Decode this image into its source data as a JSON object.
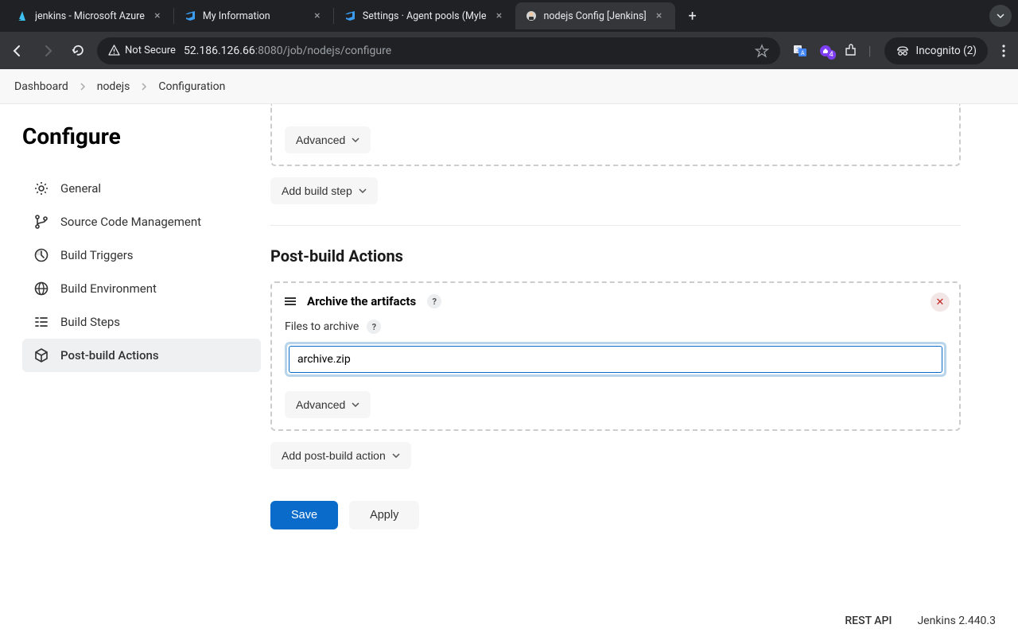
{
  "browser": {
    "tabs": [
      {
        "title": "jenkins - Microsoft Azure",
        "favicon": "azure"
      },
      {
        "title": "My Information",
        "favicon": "azuredevops"
      },
      {
        "title": "Settings · Agent pools (Myle",
        "favicon": "azuredevops"
      },
      {
        "title": "nodejs Config [Jenkins]",
        "favicon": "jenkins",
        "active": true
      }
    ],
    "not_secure": "Not Secure",
    "url_host": "52.186.126.66",
    "url_port_path": ":8080/job/nodejs/configure",
    "incognito": "Incognito (2)",
    "ext_badge": "4"
  },
  "breadcrumbs": [
    "Dashboard",
    "nodejs",
    "Configuration"
  ],
  "sidebar": {
    "title": "Configure",
    "items": [
      {
        "label": "General",
        "icon": "gear"
      },
      {
        "label": "Source Code Management",
        "icon": "branch"
      },
      {
        "label": "Build Triggers",
        "icon": "clock"
      },
      {
        "label": "Build Environment",
        "icon": "globe"
      },
      {
        "label": "Build Steps",
        "icon": "steps"
      },
      {
        "label": "Post-build Actions",
        "icon": "package",
        "active": true
      }
    ]
  },
  "content": {
    "prev_advanced": "Advanced",
    "add_build_step": "Add build step",
    "post_build_title": "Post-build Actions",
    "archive": {
      "title": "Archive the artifacts",
      "field_label": "Files to archive",
      "value": "archive.zip ",
      "advanced": "Advanced"
    },
    "add_post_build": "Add post-build action",
    "save": "Save",
    "apply": "Apply"
  },
  "footer": {
    "rest_api": "REST API",
    "version": "Jenkins 2.440.3"
  }
}
